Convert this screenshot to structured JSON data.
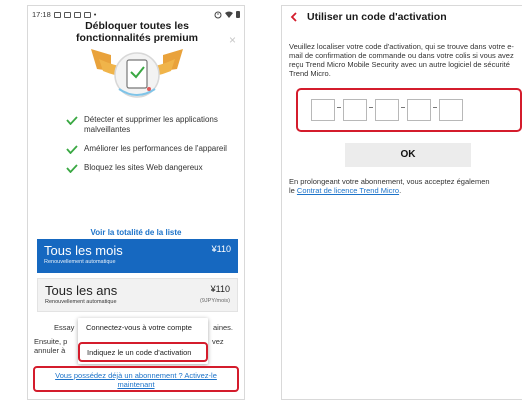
{
  "left_screen": {
    "status": {
      "time": "17:18",
      "dot": "•"
    },
    "close_icon_glyph": "×",
    "title_line1": "Débloquer toutes les",
    "title_line2": "fonctionnalités premium",
    "features": [
      "Détecter et supprimer les applications malveillantes",
      "Améliorer les performances de l'appareil",
      "Bloquez les sites Web dangereux"
    ],
    "see_full_list": "Voir la totalité de la liste",
    "plans": [
      {
        "name": "Tous les mois",
        "renew": "Renouvellement automatique",
        "price": "¥110",
        "sub": ""
      },
      {
        "name": "Tous les ans",
        "renew": "Renouvellement automatique",
        "price": "¥110",
        "sub": "(9JPY/mois)"
      }
    ],
    "background_text": {
      "essay": "Essay",
      "aines": "aines.",
      "ensuite": "Ensuite, p",
      "annuler": "annuler à",
      "vez": "vez"
    },
    "menu": {
      "connect": "Connectez-vous à votre compte",
      "enter_code": "Indiquez le un code d'activation"
    },
    "subscription_link": "Vous possédez déjà un abonnement ? Activez-le maintenant"
  },
  "right_screen": {
    "title": "Utiliser un code d'activation",
    "description": "Veuillez localiser votre code d'activation, qui se trouve dans votre e-mail de confirmation de commande ou dans votre colis si vous avez reçu Trend Micro Mobile Security avec un autre logiciel de sécurité Trend Micro.",
    "code_fields": [
      "",
      "",
      "",
      "",
      ""
    ],
    "ok_label": "OK",
    "terms_prefix": "En prolongeant votre abonnement, vous acceptez égalemen",
    "terms_le": "le ",
    "terms_link": "Contrat de licence Trend Micro",
    "terms_suffix": "."
  },
  "colors": {
    "accent_blue": "#1668c0",
    "link_blue": "#1d73c9",
    "highlight_red": "#d41c2c",
    "check_green": "#3aa843",
    "badge_orange": "#e9a23b"
  }
}
